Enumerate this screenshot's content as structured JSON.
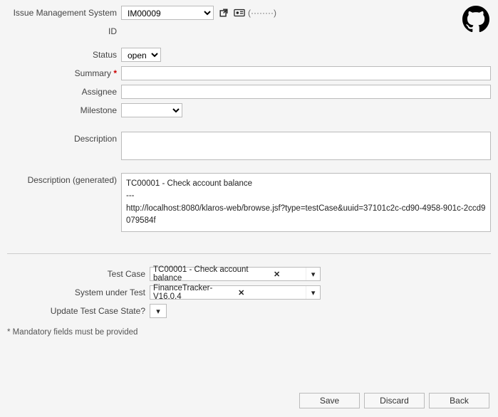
{
  "labels": {
    "issueManagementSystem": "Issue Management System",
    "id": "ID",
    "status": "Status",
    "summary": "Summary",
    "assignee": "Assignee",
    "milestone": "Milestone",
    "description": "Description",
    "descriptionGenerated": "Description (generated)",
    "testCase": "Test Case",
    "systemUnderTest": "System under Test",
    "updateTestCaseState": "Update Test Case State?"
  },
  "values": {
    "imsSelected": "IM00009",
    "credentialsMask": "(········)",
    "statusSelected": "open",
    "summary": "",
    "assignee": "",
    "milestone": "",
    "description": "",
    "generated_line1": "TC00001 - Check account balance",
    "generated_line2": "---",
    "generated_line3": "http://localhost:8080/klaros-web/browse.jsf?type=testCase&uuid=37101c2c-cd90-4958-901c-2ccd9079584f",
    "testCaseSelected": "TC00001 - Check account balance",
    "sutSelected": "FinanceTracker-V16.0.4",
    "updateStateSelected": ""
  },
  "footer": {
    "mandatoryNote": "* Mandatory fields must be provided"
  },
  "buttons": {
    "save": "Save",
    "discard": "Discard",
    "back": "Back"
  }
}
